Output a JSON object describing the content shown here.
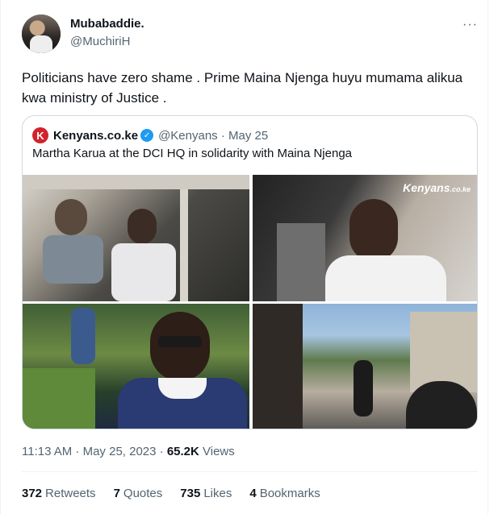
{
  "tweet": {
    "author_name": "Mubabaddie.",
    "author_handle": "@MuchiriH",
    "more_glyph": "···",
    "text_line1": "Politicians have zero shame . Prime Maina Njenga huyu mumama alikua",
    "text_line2": "kwa ministry of Justice ."
  },
  "quote": {
    "logo_letter": "K",
    "author_name": "Kenyans.co.ke",
    "verified_glyph": "✓",
    "handle_date": "@Kenyans · May 25",
    "text": "Martha Karua at the DCI HQ in solidarity with Maina Njenga",
    "watermark_main": "Kenyans",
    "watermark_sub": ".co.ke"
  },
  "meta": {
    "timestamp": "11:13 AM · May 25, 2023 · ",
    "views_count": "65.2K",
    "views_label": " Views"
  },
  "stats": [
    {
      "count": "372",
      "label": "Retweets"
    },
    {
      "count": "7",
      "label": "Quotes"
    },
    {
      "count": "735",
      "label": "Likes"
    },
    {
      "count": "4",
      "label": "Bookmarks"
    }
  ]
}
